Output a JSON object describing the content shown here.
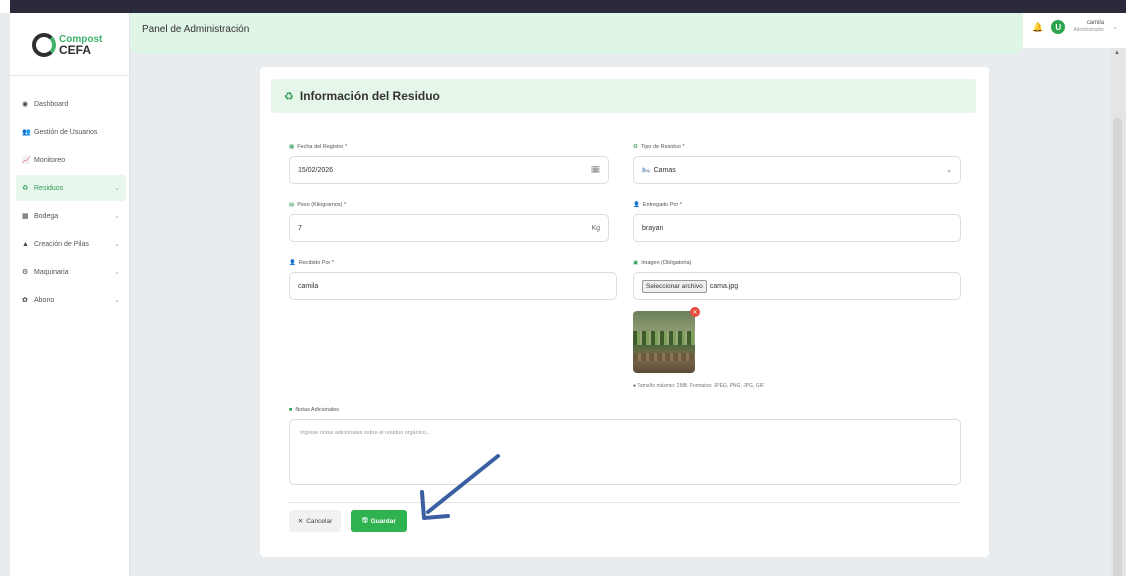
{
  "brand": {
    "top": "Compost",
    "bottom": "CEFA"
  },
  "header": {
    "title": "Panel de Administración",
    "user_name": "camila",
    "user_role": "Administrador",
    "avatar_glyph": "U"
  },
  "sidebar": {
    "items": [
      {
        "label": "Dashboard",
        "icon": "dashboard-icon",
        "glyph": "◉",
        "chevron": "",
        "active": false
      },
      {
        "label": "Gestión de Usuarios",
        "icon": "users-icon",
        "glyph": "👥",
        "chevron": "",
        "active": false
      },
      {
        "label": "Monitoreo",
        "icon": "chart-icon",
        "glyph": "📈",
        "chevron": "",
        "active": false
      },
      {
        "label": "Residuos",
        "icon": "recycle-icon",
        "glyph": "♻",
        "chevron": "⌄",
        "active": true
      },
      {
        "label": "Bodega",
        "icon": "warehouse-icon",
        "glyph": "▦",
        "chevron": "⌄",
        "active": false
      },
      {
        "label": "Creación de Pilas",
        "icon": "pile-icon",
        "glyph": "▲",
        "chevron": "⌄",
        "active": false
      },
      {
        "label": "Maquinaria",
        "icon": "tools-icon",
        "glyph": "⚙",
        "chevron": "⌄",
        "active": false
      },
      {
        "label": "Abono",
        "icon": "plant-icon",
        "glyph": "✿",
        "chevron": "⌄",
        "active": false
      }
    ]
  },
  "form": {
    "title": "Información del Residuo",
    "fecha": {
      "label": "Fecha del Registro *",
      "value": "15/02/2026"
    },
    "tipo": {
      "label": "Tipo de Residuo *",
      "value": "Camas"
    },
    "peso": {
      "label": "Peso (Kilogramos) *",
      "value": "7",
      "suffix": "Kg"
    },
    "entregado": {
      "label": "Entregado Por *",
      "value": "brayan"
    },
    "recibido": {
      "label": "Recibido Por *",
      "value": "camila"
    },
    "imagen": {
      "label": "Imagen (Obligatoria)",
      "button": "Seleccionar archivo",
      "filename": "cama.jpg",
      "hint": "Tamaño máximo: 2MB. Formatos: JPEG, PNG, JPG, GIF"
    },
    "notas": {
      "label": "Notas Adicionales",
      "placeholder": "Ingrese notas adicionales sobre el residuo orgánico..."
    },
    "cancel": "Cancelar",
    "save": "Guardar"
  },
  "colors": {
    "accent": "#2fb350",
    "accent_light": "#dff5e5",
    "danger": "#e74c3c"
  }
}
